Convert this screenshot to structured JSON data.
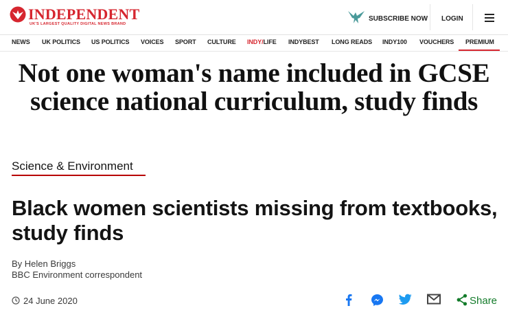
{
  "header": {
    "logo_text": "INDEPENDENT",
    "logo_tagline": "UK'S LARGEST QUALITY DIGITAL NEWS BRAND",
    "subscribe_label": "SUBSCRIBE NOW",
    "login_label": "LOGIN",
    "menu_icon": "hamburger-icon",
    "brand_color": "#d6262f"
  },
  "nav": {
    "items": [
      {
        "label": "NEWS"
      },
      {
        "label": "UK POLITICS"
      },
      {
        "label": "US POLITICS"
      },
      {
        "label": "VOICES"
      },
      {
        "label": "SPORT"
      },
      {
        "label": "CULTURE"
      },
      {
        "label_red": "INDY/",
        "label_rest": "LIFE"
      },
      {
        "label": "INDYBEST"
      },
      {
        "label": "LONG READS"
      },
      {
        "label": "INDY100"
      },
      {
        "label": "VOUCHERS"
      },
      {
        "label": "PREMIUM"
      }
    ]
  },
  "independent_headline": "Not one woman's name included in GCSE science national curriculum, study finds",
  "bbc": {
    "section": "Science & Environment",
    "headline": "Black women scientists missing from textbooks, study finds",
    "author": "By Helen Briggs",
    "author_role": "BBC Environment correspondent",
    "date": "24 June 2020",
    "share_label": "Share",
    "share_icons": [
      "facebook-icon",
      "messenger-icon",
      "twitter-icon",
      "email-icon",
      "share-icon"
    ],
    "accent_color": "#b80000",
    "share_color": "#137b2a"
  }
}
